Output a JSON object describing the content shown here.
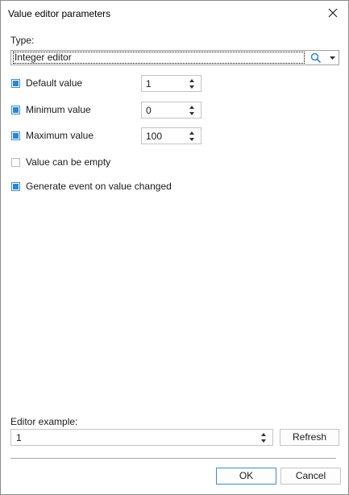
{
  "dialog": {
    "title": "Value editor parameters"
  },
  "type_section": {
    "label": "Type:",
    "value": "Integer editor"
  },
  "options": [
    {
      "label": "Default value",
      "checked": true,
      "spin_value": "1"
    },
    {
      "label": "Minimum value",
      "checked": true,
      "spin_value": "0"
    },
    {
      "label": "Maximum value",
      "checked": true,
      "spin_value": "100"
    },
    {
      "label": "Value can be empty",
      "checked": false
    },
    {
      "label": "Generate event on value changed",
      "checked": true
    }
  ],
  "example": {
    "label": "Editor example:",
    "value": "1",
    "refresh_label": "Refresh"
  },
  "footer": {
    "ok_label": "OK",
    "cancel_label": "Cancel"
  },
  "colors": {
    "accent": "#2d86cf",
    "border": "#c4c4c4"
  }
}
